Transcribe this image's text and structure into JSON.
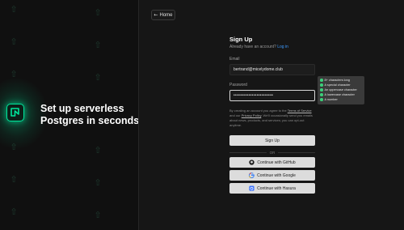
{
  "brand": {
    "tagline_line1": "Set up serverless",
    "tagline_line2": "Postgres in seconds.",
    "accent": "#00e59b"
  },
  "nav": {
    "home_label": "Home"
  },
  "signup": {
    "title": "Sign Up",
    "have_account": "Already have an account?",
    "login_link": "Log in",
    "email_label": "Email",
    "email_value": "bertrand@micelydome.club",
    "password_label": "Password",
    "password_value": "••••••••••••••••••••••••",
    "legal_prefix": "By creating an account you agree to the",
    "terms_link": "Terms of Service",
    "legal_and": "and our",
    "privacy_link": "Privacy Policy",
    "legal_suffix": ". We'll occasionally send you emails about news, products, and services; you can opt-out anytime.",
    "submit_label": "Sign Up",
    "or_label": "OR",
    "github_label": "Continue with GitHub",
    "google_label": "Continue with Google",
    "hasura_label": "Continue with Hasura"
  },
  "password_requirements": [
    "8+ characters long",
    "A special character",
    "An uppercase character",
    "A lowercase character",
    "A number"
  ]
}
